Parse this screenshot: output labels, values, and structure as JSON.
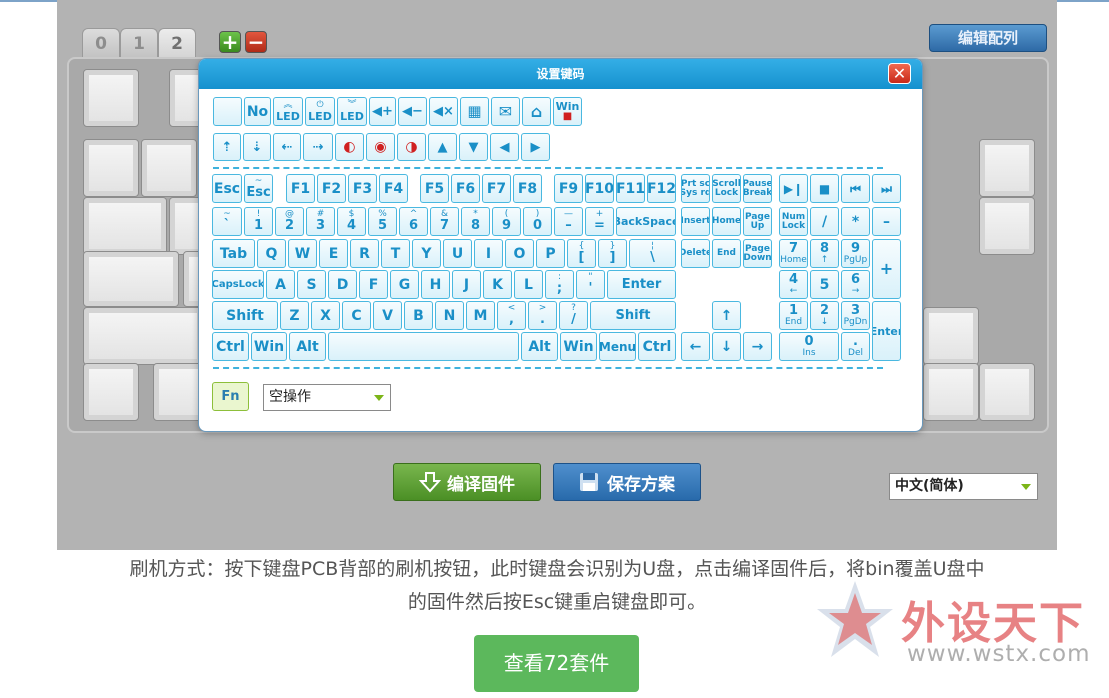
{
  "layer_tabs": [
    "0",
    "1",
    "2"
  ],
  "add_layer": "+",
  "remove_layer": "−",
  "edit_layout_label": "编辑配列",
  "compile_label": "编译固件",
  "save_label": "保存方案",
  "language_select": "中文(简体)",
  "dialog": {
    "title": "设置键码",
    "close": "✕",
    "fn_label": "Fn",
    "action_select": "空操作",
    "row1": [
      "",
      "No"
    ],
    "keys": {
      "esc": "Esc",
      "tilde_esc_top": "~",
      "tilde_esc_bot": "Esc",
      "f1": "F1",
      "f2": "F2",
      "f3": "F3",
      "f4": "F4",
      "f5": "F5",
      "f6": "F6",
      "f7": "F7",
      "f8": "F8",
      "f9": "F9",
      "f10": "F10",
      "f11": "F11",
      "f12": "F12",
      "prtsc_top": "Prt sc",
      "prtsc_bot": "Sys rq",
      "scroll_top": "Scroll",
      "scroll_bot": "Lock",
      "pause_top": "Pause",
      "pause_bot": "Break",
      "n_tilde_top": "~",
      "n_tilde_bot": "`",
      "n1_top": "!",
      "n1_bot": "1",
      "n2_top": "@",
      "n2_bot": "2",
      "n3_top": "#",
      "n3_bot": "3",
      "n4_top": "$",
      "n4_bot": "4",
      "n5_top": "%",
      "n5_bot": "5",
      "n6_top": "^",
      "n6_bot": "6",
      "n7_top": "&",
      "n7_bot": "7",
      "n8_top": "*",
      "n8_bot": "8",
      "n9_top": "(",
      "n9_bot": "9",
      "n0_top": ")",
      "n0_bot": "0",
      "minus_top": "—",
      "minus_bot": "–",
      "plus_top": "+",
      "plus_bot": "=",
      "backspace": "BackSpace",
      "insert": "Insert",
      "home": "Home",
      "pgup_top": "Page",
      "pgup_bot": "Up",
      "numlock_top": "Num",
      "numlock_bot": "Lock",
      "np_div": "/",
      "np_mul": "*",
      "np_minus": "–",
      "tab": "Tab",
      "q": "Q",
      "w": "W",
      "e": "E",
      "r": "R",
      "t": "T",
      "y": "Y",
      "u": "U",
      "i": "I",
      "o": "O",
      "p": "P",
      "lbr_top": "{",
      "lbr_bot": "[",
      "rbr_top": "}",
      "rbr_bot": "]",
      "bsl_top": "¦",
      "bsl_bot": "\\",
      "delete": "Delete",
      "end": "End",
      "pgdn_top": "Page",
      "pgdn_bot": "Down",
      "np7_top": "7",
      "np7_bot": "Home",
      "np8_top": "8",
      "np8_bot": "↑",
      "np9_top": "9",
      "np9_bot": "PgUp",
      "np_plus": "+",
      "caps": "CapsLock",
      "a": "A",
      "s": "S",
      "d": "D",
      "f": "F",
      "g": "G",
      "h": "H",
      "j": "J",
      "k": "K",
      "l": "L",
      "semi_top": ":",
      "semi_bot": ";",
      "quote_top": "\"",
      "quote_bot": "'",
      "enter": "Enter",
      "np4_top": "4",
      "np4_bot": "←",
      "np5": "5",
      "np6_top": "6",
      "np6_bot": "→",
      "lshift": "Shift",
      "z": "Z",
      "x": "X",
      "c": "C",
      "v": "V",
      "b": "B",
      "n": "N",
      "m": "M",
      "comma_top": "<",
      "comma_bot": ",",
      "period_top": ">",
      "period_bot": ".",
      "slash_top": "?",
      "slash_bot": "/",
      "rshift": "Shift",
      "up": "↑",
      "np1_top": "1",
      "np1_bot": "End",
      "np2_top": "2",
      "np2_bot": "↓",
      "np3_top": "3",
      "np3_bot": "PgDn",
      "np_enter": "Enter",
      "lctrl": "Ctrl",
      "lwin": "Win",
      "lalt": "Alt",
      "ralt": "Alt",
      "rwin": "Win",
      "menu": "Menu",
      "rctrl": "Ctrl",
      "left": "←",
      "down": "↓",
      "right": "→",
      "np0_top": "0",
      "np0_bot": "Ins",
      "npdot_top": ".",
      "npdot_bot": "Del"
    },
    "special": {
      "led1": "LED",
      "led2": "LED",
      "led3": "LED",
      "win_lock": "Win"
    }
  },
  "description_line1": "刷机方式：按下键盘PCB背部的刷机按钮，此时键盘会识别为U盘，点击编译固件后，将bin覆盖U盘中",
  "description_line2": "的固件然后按Esc键重启键盘即可。",
  "view_button": "查看72套件",
  "watermark_text": "外设天下",
  "watermark_url": "www.wstx.com"
}
